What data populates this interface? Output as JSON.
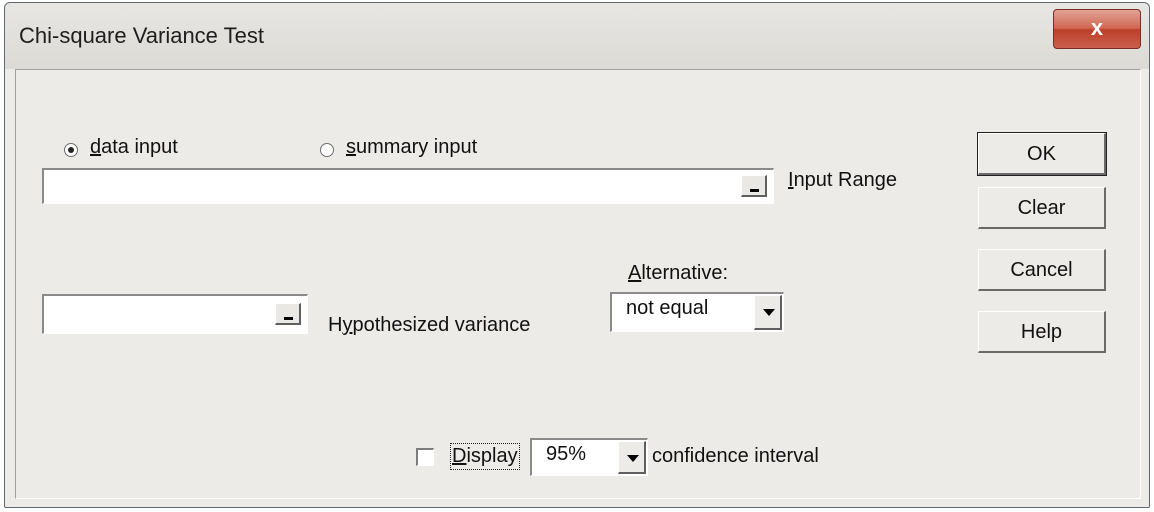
{
  "window": {
    "title": "Chi-square Variance Test",
    "close_glyph": "x"
  },
  "input_mode": {
    "data_input": "data input",
    "summary_input": "summary input",
    "selected": "data input"
  },
  "input_range": {
    "label": "Input Range",
    "value": ""
  },
  "hypothesized_variance": {
    "label": "Hypothesized variance",
    "value": ""
  },
  "alternative": {
    "label": "Alternative:",
    "value": "not equal"
  },
  "confidence": {
    "display_label": "Display",
    "level": "95%",
    "suffix": "confidence interval",
    "checked": false
  },
  "buttons": {
    "ok": "OK",
    "clear": "Clear",
    "cancel": "Cancel",
    "help": "Help"
  }
}
